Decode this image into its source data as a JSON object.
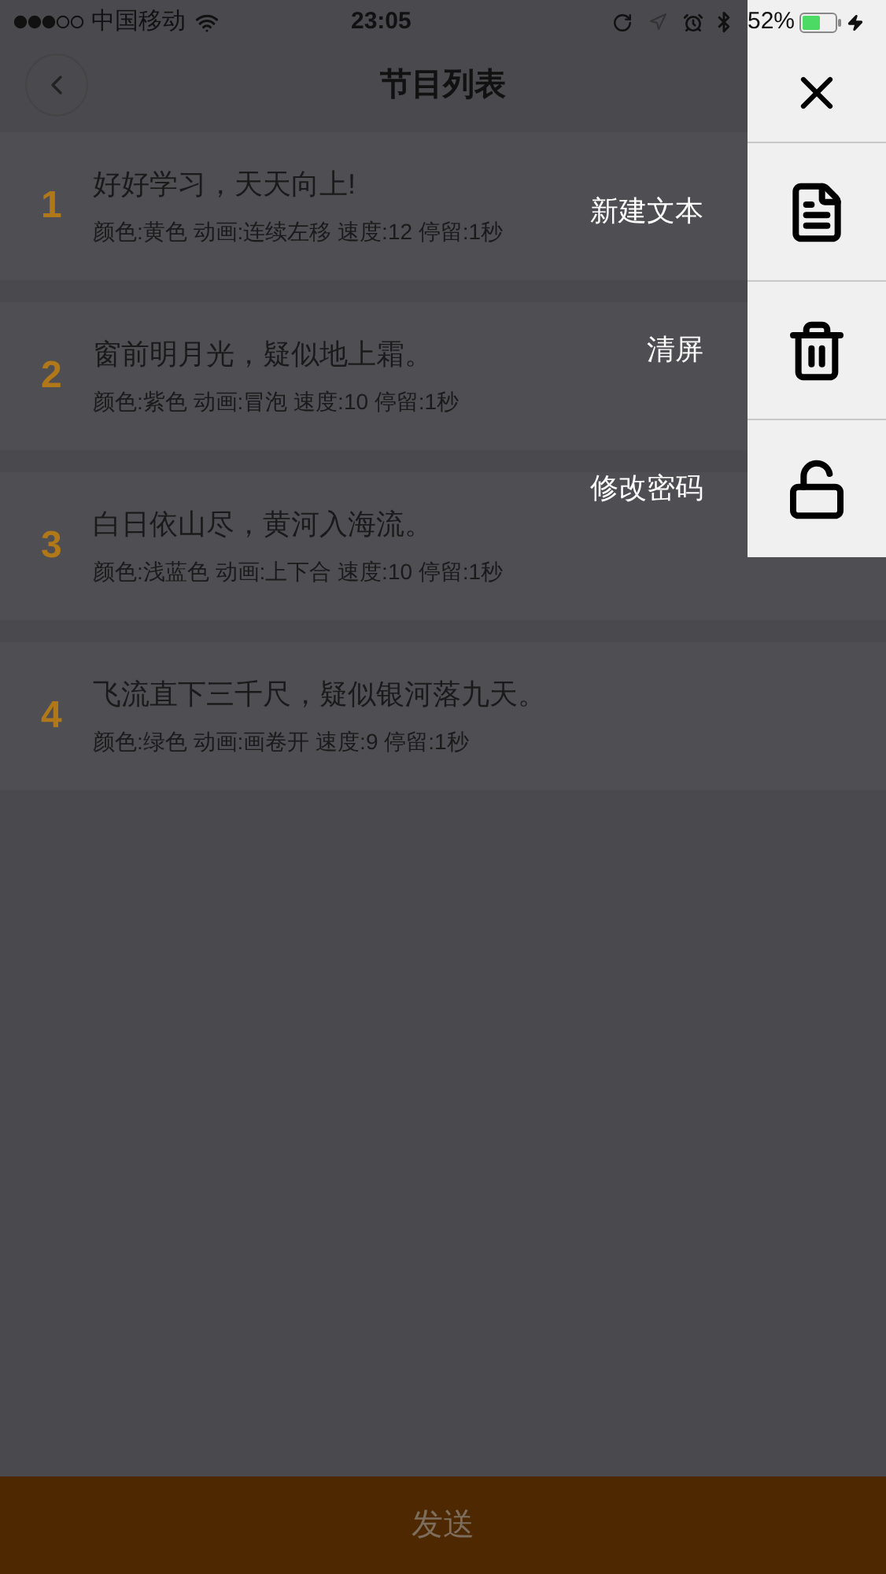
{
  "status_bar": {
    "carrier": "中国移动",
    "time": "23:05",
    "battery": "52%"
  },
  "nav": {
    "title": "节目列表"
  },
  "programs": [
    {
      "number": "1",
      "title": "好好学习，天天向上!",
      "detail": "颜色:黄色 动画:连续左移 速度:12 停留:1秒"
    },
    {
      "number": "2",
      "title": "窗前明月光，疑似地上霜。",
      "detail": "颜色:紫色 动画:冒泡 速度:10 停留:1秒"
    },
    {
      "number": "3",
      "title": "白日依山尽，黄河入海流。",
      "detail": "颜色:浅蓝色 动画:上下合 速度:10 停留:1秒"
    },
    {
      "number": "4",
      "title": "飞流直下三千尺，疑似银河落九天。",
      "detail": "颜色:绿色 动画:画卷开 速度:9 停留:1秒"
    }
  ],
  "menu": [
    {
      "kind": "close"
    },
    {
      "kind": "document",
      "label": "新建文本"
    },
    {
      "kind": "trash",
      "label": "清屏"
    },
    {
      "kind": "unlock",
      "label": "修改密码"
    }
  ],
  "send_button": {
    "label": "发送"
  }
}
